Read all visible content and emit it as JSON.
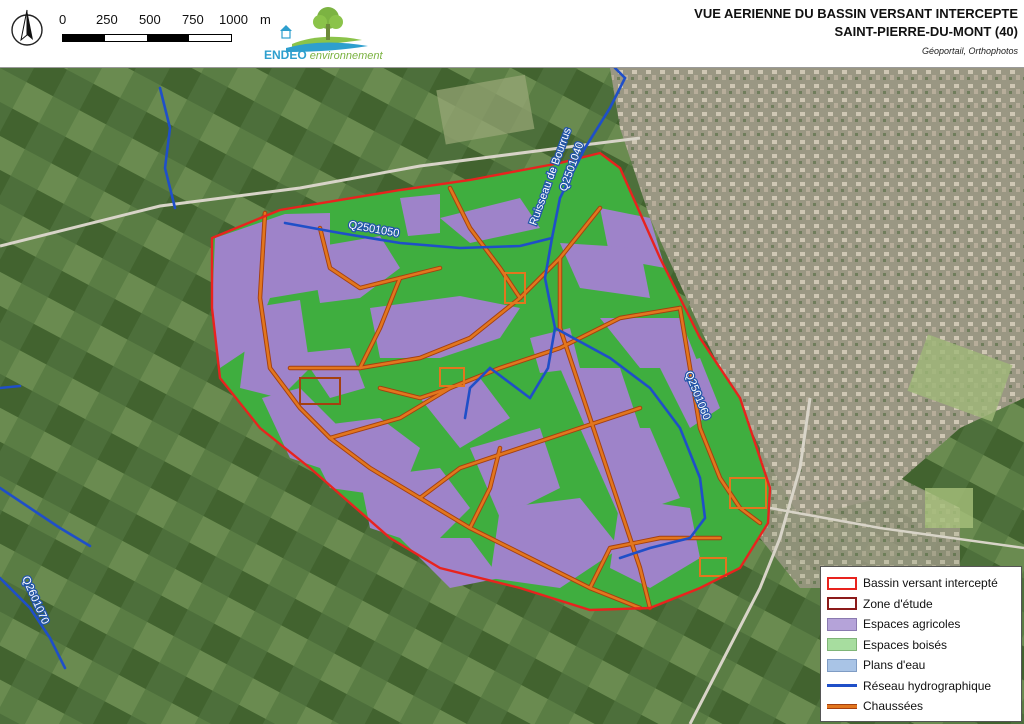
{
  "header": {
    "title_line1": "VUE AERIENNE DU BASSIN VERSANT INTERCEPTE",
    "title_line2": "SAINT-PIERRE-DU-MONT (40)",
    "source": "Géoportail, Orthophotos"
  },
  "north_arrow": {
    "icon": "north-arrow-icon"
  },
  "scale": {
    "ticks": [
      "0",
      "250",
      "500",
      "750",
      "1000"
    ],
    "unit": "m"
  },
  "logo": {
    "name_part1": "ENDEO",
    "name_part2": "environnement",
    "icon": "tree-landscape-icon"
  },
  "map_labels": {
    "stream_q2501050": "Q2501050",
    "stream_q2501040": "Q2501040",
    "stream_ruisseau": "Ruisseau de Bourrus",
    "stream_q2501060": "Q2501060",
    "stream_q2601070": "Q2601070"
  },
  "legend": {
    "items": [
      {
        "label": "Bassin versant intercepté",
        "symbol": "outline",
        "color": "#e8231e"
      },
      {
        "label": "Zone d'étude",
        "symbol": "outline",
        "color": "#8b1a1a"
      },
      {
        "label": "Espaces agricoles",
        "symbol": "fill",
        "color": "#b5a3d9"
      },
      {
        "label": "Espaces boisés",
        "symbol": "fill",
        "color": "#a7dd9f"
      },
      {
        "label": "Plans d'eau",
        "symbol": "fill",
        "color": "#a9c4e6"
      },
      {
        "label": "Réseau hydrographique",
        "symbol": "line",
        "color": "#1f4fc8"
      },
      {
        "label": "Chaussées",
        "symbol": "road",
        "color": "#e2761e"
      }
    ]
  },
  "colors": {
    "basin_outline": "#e8231e",
    "agricultural": "#9e83c9",
    "forest": "#3fae3f",
    "water_network": "#1f4fc8",
    "roads": "#e2761e",
    "aerial_base": "#4a6b3a"
  }
}
